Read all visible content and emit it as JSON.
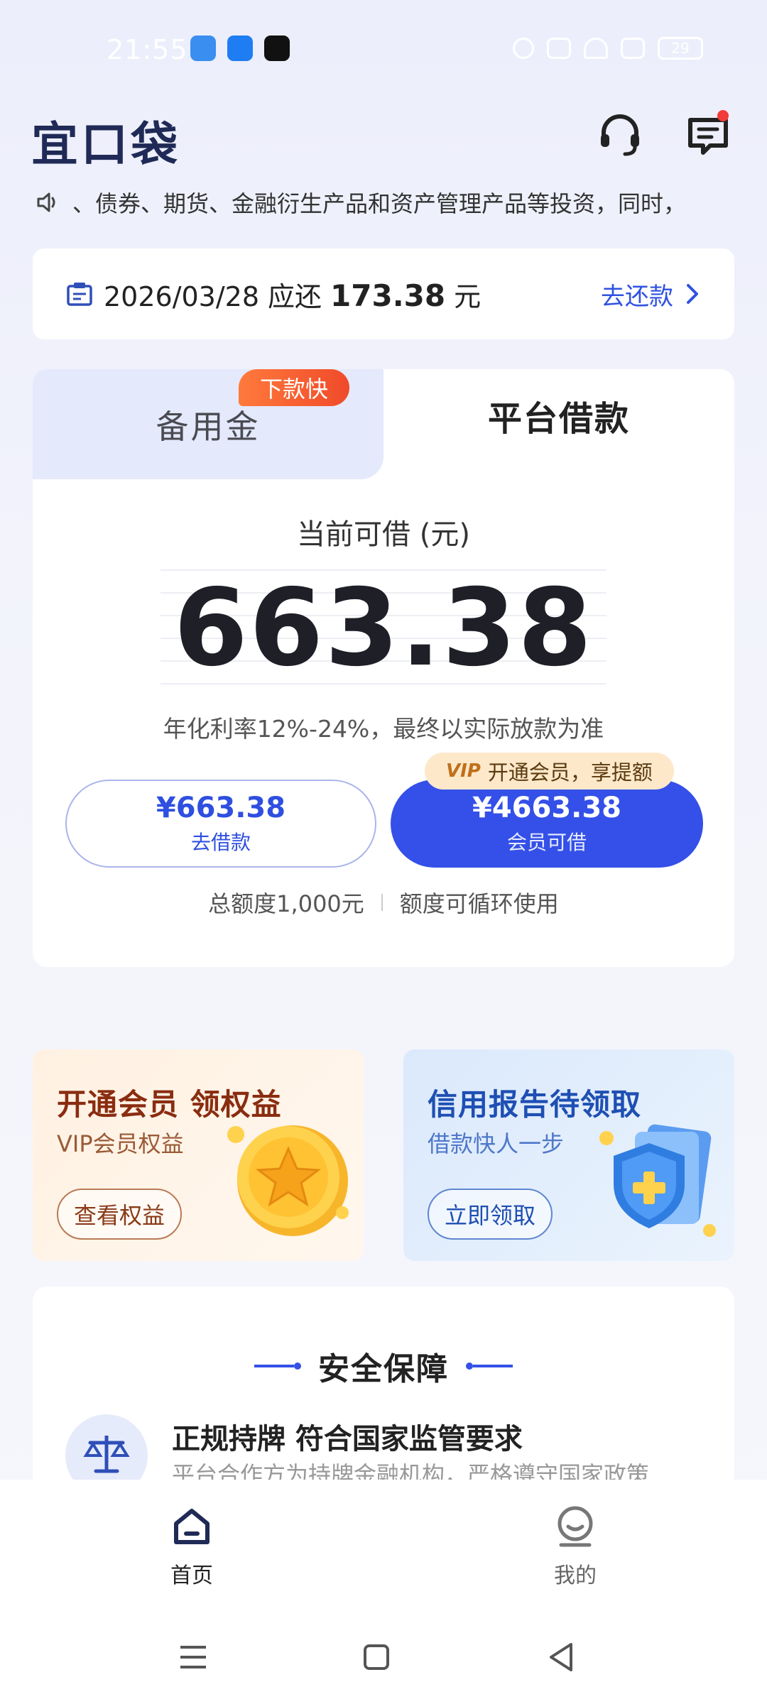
{
  "status_bar": {
    "time": "21:55",
    "battery": "29"
  },
  "header": {
    "logo": "宜口袋",
    "support_icon": "headset-icon",
    "message_icon": "message-icon"
  },
  "ticker": {
    "icon": "speaker-icon",
    "text": "、债券、期货、金融衍生产品和资产管理产品等投资，同时，"
  },
  "repayment": {
    "date": "2026/03/28",
    "due_label": "应还",
    "amount": "173.38",
    "unit": "元",
    "link": "去还款"
  },
  "loan_card": {
    "tabs": [
      "备用金",
      "平台借款"
    ],
    "badge": "下款快",
    "available_label": "当前可借 (元)",
    "available_amount": "663.38",
    "rate_note": "年化利率12%-24%，最终以实际放款为准",
    "borrow_button": {
      "amount": "¥663.38",
      "label": "去借款"
    },
    "vip_button": {
      "amount": "¥4663.38",
      "label": "会员可借"
    },
    "vip_tag": {
      "vip": "VIP",
      "text": "开通会员，享提额"
    },
    "quota_total": "总额度1,000元",
    "quota_note": "额度可循环使用"
  },
  "promos": [
    {
      "title": "开通会员 领权益",
      "subtitle": "VIP会员权益",
      "button": "查看权益",
      "colors": {
        "accent": "#8a2c10"
      }
    },
    {
      "title": "信用报告待领取",
      "subtitle": "借款快人一步",
      "button": "立即领取",
      "colors": {
        "accent": "#1e4fb3"
      }
    }
  ],
  "security": {
    "title": "安全保障",
    "item_title": "正规持牌 符合国家监管要求",
    "item_desc": "平台合作方为持牌金融机构，严格遵守国家政策"
  },
  "bottom_nav": {
    "items": [
      {
        "label": "首页",
        "icon": "home-icon"
      },
      {
        "label": "我的",
        "icon": "profile-icon"
      }
    ]
  },
  "colors": {
    "primary": "#3450e8",
    "badge_orange": "#f04a2a",
    "vip_tag_bg": "#fde8c9"
  }
}
